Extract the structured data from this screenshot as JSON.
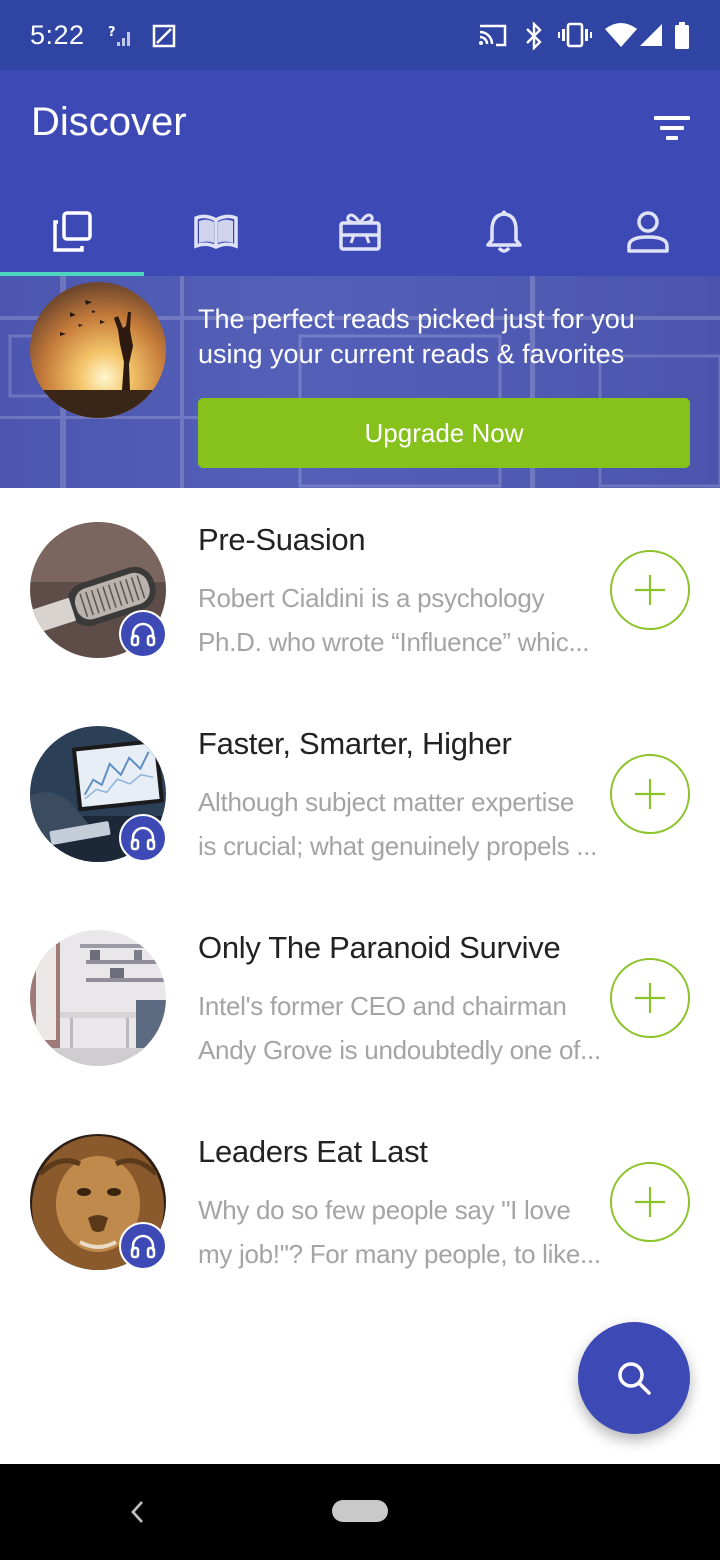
{
  "status_bar": {
    "time": "5:22"
  },
  "app_bar": {
    "title": "Discover",
    "tabs": [
      {
        "icon": "cards-icon",
        "active": true
      },
      {
        "icon": "book-icon",
        "active": false
      },
      {
        "icon": "gift-icon",
        "active": false
      },
      {
        "icon": "bell-icon",
        "active": false
      },
      {
        "icon": "profile-icon",
        "active": false
      }
    ],
    "accent_color": "#3d4ab6",
    "indicator_color": "#4dd5c0"
  },
  "promo": {
    "line1": "The perfect reads picked just for you",
    "line2": "using your current reads & favorites",
    "button_label": "Upgrade Now",
    "button_color": "#86c11c"
  },
  "books": [
    {
      "title": "Pre-Suasion",
      "desc_line1": "Robert Cialdini is a psychology",
      "desc_line2": "Ph.D. who wrote “Influence” whic...",
      "audio": true
    },
    {
      "title": "Faster, Smarter, Higher",
      "desc_line1": "Although subject matter expertise",
      "desc_line2": "is crucial; what genuinely propels ...",
      "audio": true
    },
    {
      "title": "Only The Paranoid Survive",
      "desc_line1": "Intel's former CEO and chairman",
      "desc_line2": "Andy Grove is undoubtedly one of...",
      "audio": false
    },
    {
      "title": "Leaders Eat Last",
      "desc_line1": "Why do so few people say \"I love",
      "desc_line2": "my job!\"? For many people, to like...",
      "audio": true
    }
  ]
}
